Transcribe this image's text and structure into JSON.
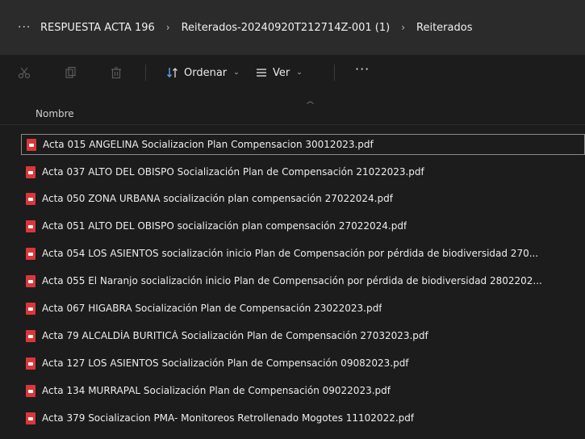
{
  "breadcrumb": {
    "overflow_icon": "more-horizontal-icon",
    "separator": "›",
    "items": [
      "RESPUESTA ACTA 196",
      "Reiterados-20240920T212714Z-001 (1)",
      "Reiterados"
    ]
  },
  "toolbar": {
    "sort_label": "Ordenar",
    "view_label": "Ver",
    "more_label": "···",
    "icons": [
      "cut-icon",
      "copy-icon",
      "delete-icon",
      "sort-icon",
      "view-icon"
    ]
  },
  "list_header": {
    "name_label": "Nombre"
  },
  "files": [
    {
      "name": "Acta 015 ANGELINA Socializacion Plan Compensacion 30012023.pdf",
      "icon": "pdf-file-icon"
    },
    {
      "name": "Acta 037 ALTO DEL OBISPO Socialización Plan de Compensación 21022023.pdf",
      "icon": "pdf-file-icon"
    },
    {
      "name": "Acta 050 ZONA URBANA socialización plan compensación 27022024.pdf",
      "icon": "pdf-file-icon"
    },
    {
      "name": "Acta 051 ALTO DEL OBISPO socialización plan compensación 27022024.pdf",
      "icon": "pdf-file-icon"
    },
    {
      "name": "Acta 054 LOS ASIENTOS socialización inicio Plan de Compensación por pérdida de biodiversidad 270...",
      "icon": "pdf-file-icon"
    },
    {
      "name": "Acta 055 El Naranjo socialización inicio Plan de Compensación por pérdida de biodiversidad 2802202...",
      "icon": "pdf-file-icon"
    },
    {
      "name": "Acta 067 HIGABRA Socialización Plan de Compensación 23022023.pdf",
      "icon": "pdf-file-icon"
    },
    {
      "name": "Acta 79 ALCALDÍA BURITICÁ Socialización Plan de Compensación 27032023.pdf",
      "icon": "pdf-file-icon"
    },
    {
      "name": "Acta 127 LOS ASIENTOS Socialización Plan de Compensación 09082023.pdf",
      "icon": "pdf-file-icon"
    },
    {
      "name": "Acta 134 MURRAPAL Socialización Plan de Compensación 09022023.pdf",
      "icon": "pdf-file-icon"
    },
    {
      "name": "Acta 379  Socializacion PMA- Monitoreos Retrollenado  Mogotes 11102022.pdf",
      "icon": "pdf-file-icon"
    }
  ],
  "colors": {
    "background": "#1c1c1c",
    "breadcrumb_bar": "#2b2b2b",
    "pdf_icon": "#d9373b",
    "text": "#ededed"
  }
}
